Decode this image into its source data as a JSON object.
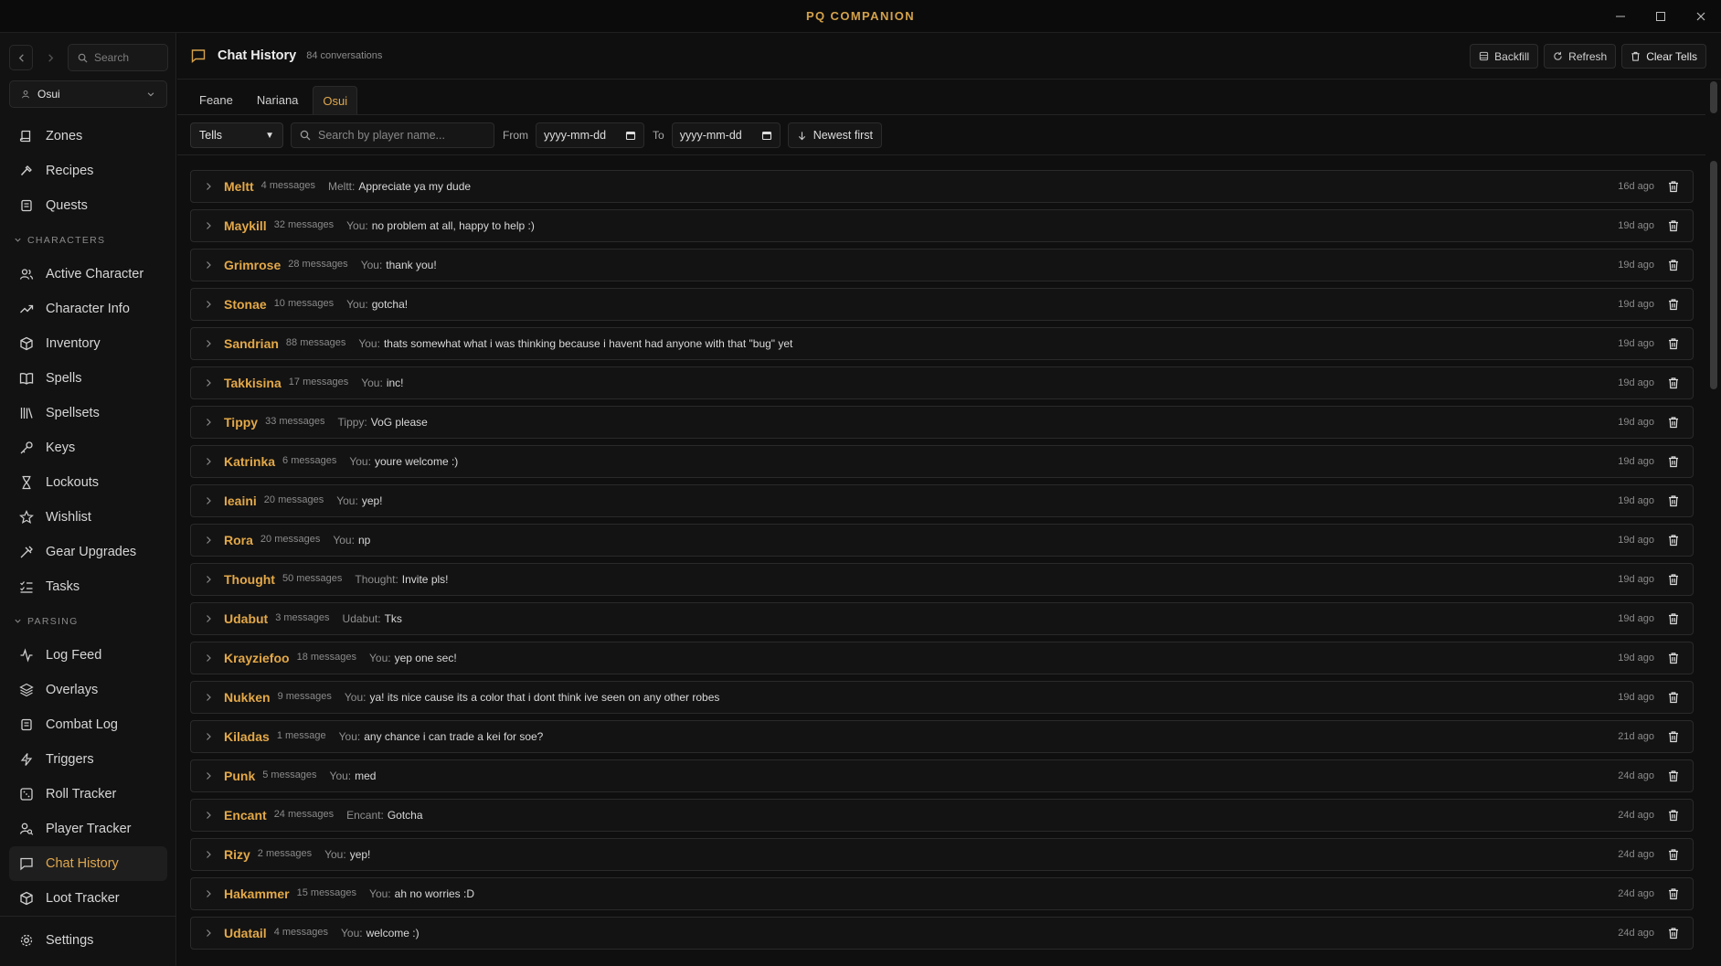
{
  "app": {
    "title": "PQ COMPANION"
  },
  "sidebar": {
    "search_placeholder": "Search",
    "character": "Osui",
    "top_items": [
      {
        "label": "Zones",
        "icon": "book-icon"
      },
      {
        "label": "Recipes",
        "icon": "hammer-icon"
      },
      {
        "label": "Quests",
        "icon": "scroll-icon"
      }
    ],
    "characters_section": "CHARACTERS",
    "character_items": [
      {
        "label": "Active Character",
        "icon": "users-icon"
      },
      {
        "label": "Character Info",
        "icon": "trending-icon"
      },
      {
        "label": "Inventory",
        "icon": "package-icon"
      },
      {
        "label": "Spells",
        "icon": "book-open-icon"
      },
      {
        "label": "Spellsets",
        "icon": "library-icon"
      },
      {
        "label": "Keys",
        "icon": "key-icon"
      },
      {
        "label": "Lockouts",
        "icon": "hourglass-icon"
      },
      {
        "label": "Wishlist",
        "icon": "star-icon"
      },
      {
        "label": "Gear Upgrades",
        "icon": "gear-upgrade-icon"
      },
      {
        "label": "Tasks",
        "icon": "list-check-icon"
      }
    ],
    "parsing_section": "PARSING",
    "parsing_items": [
      {
        "label": "Log Feed",
        "icon": "activity-icon"
      },
      {
        "label": "Overlays",
        "icon": "layers-icon"
      },
      {
        "label": "Combat Log",
        "icon": "scroll-icon"
      },
      {
        "label": "Triggers",
        "icon": "zap-icon"
      },
      {
        "label": "Roll Tracker",
        "icon": "dice-icon"
      },
      {
        "label": "Player Tracker",
        "icon": "user-search-icon"
      },
      {
        "label": "Chat History",
        "icon": "message-icon",
        "active": true
      },
      {
        "label": "Loot Tracker",
        "icon": "package-icon"
      }
    ],
    "settings": "Settings"
  },
  "header": {
    "title": "Chat History",
    "count": "84 conversations",
    "backfill": "Backfill",
    "refresh": "Refresh",
    "clear": "Clear Tells"
  },
  "tabs": [
    {
      "label": "Feane"
    },
    {
      "label": "Nariana"
    },
    {
      "label": "Osui",
      "active": true
    }
  ],
  "filters": {
    "type": "Tells",
    "search_placeholder": "Search by player name...",
    "from_label": "From",
    "to_label": "To",
    "date_placeholder": "yyyy-mm-dd",
    "sort": "Newest first"
  },
  "conversations": [
    {
      "name": "Meltt",
      "count": "4 messages",
      "who": "Meltt:",
      "text": "Appreciate ya my dude",
      "ago": "16d ago"
    },
    {
      "name": "Maykill",
      "count": "32 messages",
      "who": "You:",
      "text": "no problem at all, happy to help :)",
      "ago": "19d ago"
    },
    {
      "name": "Grimrose",
      "count": "28 messages",
      "who": "You:",
      "text": "thank you!",
      "ago": "19d ago"
    },
    {
      "name": "Stonae",
      "count": "10 messages",
      "who": "You:",
      "text": "gotcha!",
      "ago": "19d ago"
    },
    {
      "name": "Sandrian",
      "count": "88 messages",
      "who": "You:",
      "text": "thats somewhat what i was thinking because i havent had anyone with that \"bug\" yet",
      "ago": "19d ago"
    },
    {
      "name": "Takkisina",
      "count": "17 messages",
      "who": "You:",
      "text": "inc!",
      "ago": "19d ago"
    },
    {
      "name": "Tippy",
      "count": "33 messages",
      "who": "Tippy:",
      "text": "VoG please",
      "ago": "19d ago"
    },
    {
      "name": "Katrinka",
      "count": "6 messages",
      "who": "You:",
      "text": "youre welcome :)",
      "ago": "19d ago"
    },
    {
      "name": "Ieaini",
      "count": "20 messages",
      "who": "You:",
      "text": "yep!",
      "ago": "19d ago"
    },
    {
      "name": "Rora",
      "count": "20 messages",
      "who": "You:",
      "text": "np",
      "ago": "19d ago"
    },
    {
      "name": "Thought",
      "count": "50 messages",
      "who": "Thought:",
      "text": "Invite pls!",
      "ago": "19d ago"
    },
    {
      "name": "Udabut",
      "count": "3 messages",
      "who": "Udabut:",
      "text": "Tks",
      "ago": "19d ago"
    },
    {
      "name": "Krayziefoo",
      "count": "18 messages",
      "who": "You:",
      "text": "yep one sec!",
      "ago": "19d ago"
    },
    {
      "name": "Nukken",
      "count": "9 messages",
      "who": "You:",
      "text": "ya! its nice cause its a color that i dont think ive seen on any other robes",
      "ago": "19d ago"
    },
    {
      "name": "Kiladas",
      "count": "1 message",
      "who": "You:",
      "text": "any chance i can trade a kei for soe?",
      "ago": "21d ago"
    },
    {
      "name": "Punk",
      "count": "5 messages",
      "who": "You:",
      "text": "med",
      "ago": "24d ago"
    },
    {
      "name": "Encant",
      "count": "24 messages",
      "who": "Encant:",
      "text": "Gotcha",
      "ago": "24d ago"
    },
    {
      "name": "Rizy",
      "count": "2 messages",
      "who": "You:",
      "text": "yep!",
      "ago": "24d ago"
    },
    {
      "name": "Hakammer",
      "count": "15 messages",
      "who": "You:",
      "text": "ah no worries :D",
      "ago": "24d ago"
    },
    {
      "name": "Udatail",
      "count": "4 messages",
      "who": "You:",
      "text": "welcome :)",
      "ago": "24d ago"
    }
  ],
  "colors": {
    "accent": "#e3a848",
    "background": "#0f0f0f"
  }
}
